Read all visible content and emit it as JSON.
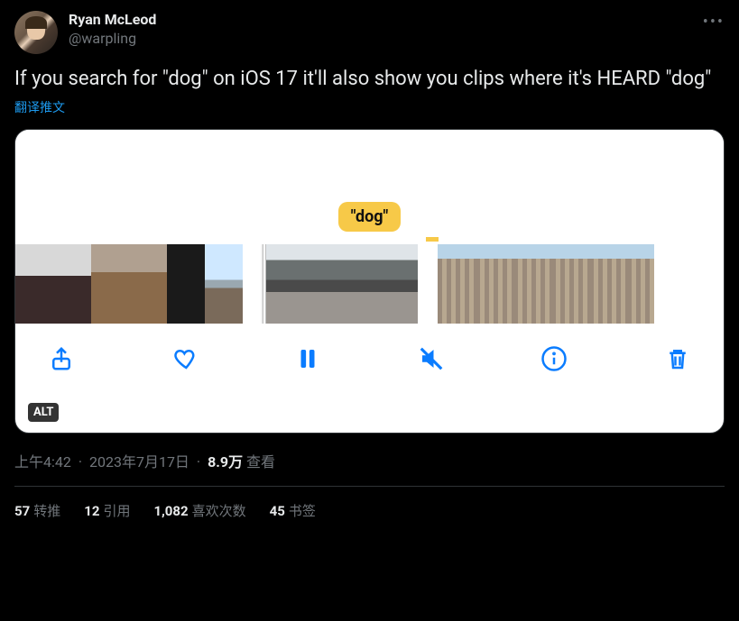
{
  "author": {
    "display_name": "Ryan McLeod",
    "handle": "@warpling"
  },
  "tweet_text": "If you search for \"dog\" on iOS 17 it'll also show you clips where it's HEARD \"dog\"",
  "translate_label": "翻译推文",
  "media": {
    "badge_text": "\"dog\"",
    "alt_label": "ALT",
    "toolbar_icons": [
      "share",
      "heart",
      "pause",
      "mute",
      "info",
      "trash"
    ]
  },
  "meta": {
    "time": "上午4:42",
    "date": "2023年7月17日",
    "views_count": "8.9万",
    "views_label": "查看"
  },
  "stats": {
    "retweets": {
      "count": "57",
      "label": "转推"
    },
    "quotes": {
      "count": "12",
      "label": "引用"
    },
    "likes": {
      "count": "1,082",
      "label": "喜欢次数"
    },
    "bookmarks": {
      "count": "45",
      "label": "书签"
    }
  },
  "more_glyph": "•••"
}
